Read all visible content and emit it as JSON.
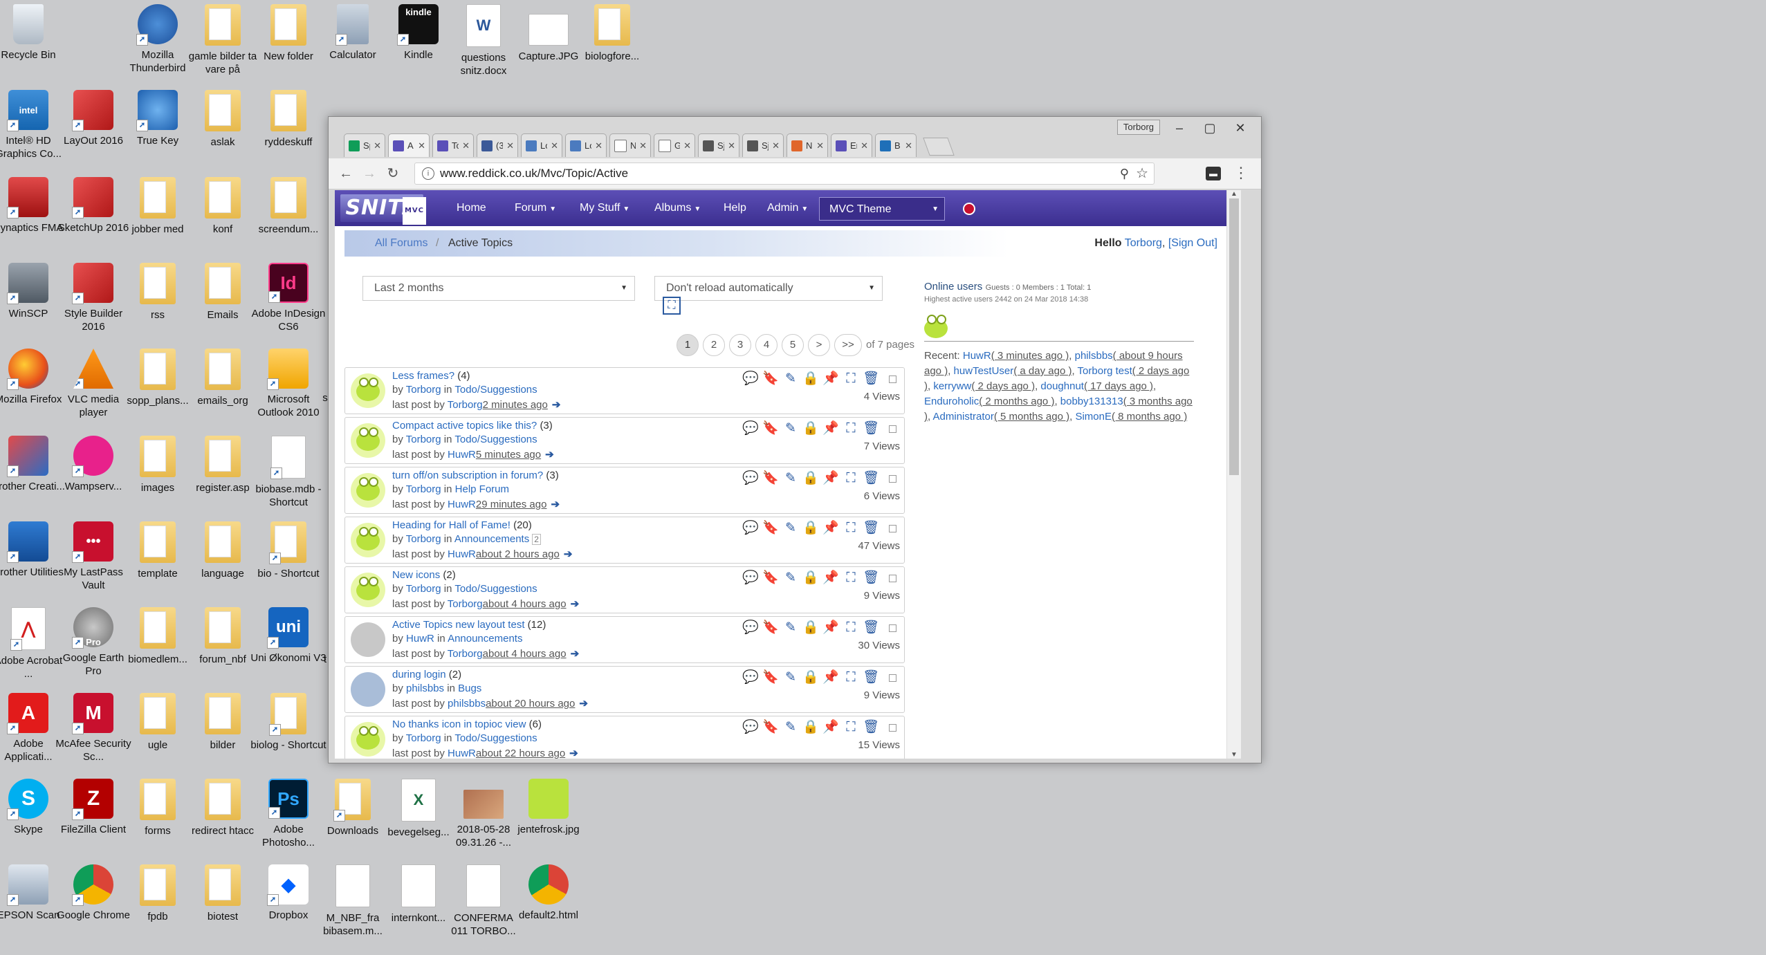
{
  "desktop": {
    "icons": [
      {
        "label": "Recycle Bin"
      },
      {
        "label": "Mozilla Thunderbird"
      },
      {
        "label": "gamle bilder ta vare på"
      },
      {
        "label": "New folder"
      },
      {
        "label": "Calculator"
      },
      {
        "label": "Kindle",
        "text": "kindle"
      },
      {
        "label": "questions snitz.docx"
      },
      {
        "label": "Capture.JPG"
      },
      {
        "label": "biologfore..."
      },
      {
        "label": "Intel® HD Graphics Co...",
        "text": "intel"
      },
      {
        "label": "LayOut 2016"
      },
      {
        "label": "True Key"
      },
      {
        "label": "aslak"
      },
      {
        "label": "ryddeskuff"
      },
      {
        "label": "Synaptics FMA"
      },
      {
        "label": "SketchUp 2016"
      },
      {
        "label": "jobber med"
      },
      {
        "label": "konf"
      },
      {
        "label": "screendum..."
      },
      {
        "label": "WinSCP"
      },
      {
        "label": "Style Builder 2016"
      },
      {
        "label": "rss"
      },
      {
        "label": "Emails"
      },
      {
        "label": "Adobe InDesign CS6",
        "text": "Id"
      },
      {
        "label": "Mozilla Firefox"
      },
      {
        "label": "VLC media player"
      },
      {
        "label": "sopp_plans..."
      },
      {
        "label": "emails_org"
      },
      {
        "label": "Microsoft Outlook 2010"
      },
      {
        "label": "s"
      },
      {
        "label": "Brother Creati..."
      },
      {
        "label": "Wampserv..."
      },
      {
        "label": "images"
      },
      {
        "label": "register.asp"
      },
      {
        "label": "biobase.mdb - Shortcut"
      },
      {
        "label": "Brother Utilities"
      },
      {
        "label": "My LastPass Vault"
      },
      {
        "label": "template"
      },
      {
        "label": "language"
      },
      {
        "label": "bio - Shortcut"
      },
      {
        "label": "Adobe Acrobat ..."
      },
      {
        "label": "Google Earth Pro",
        "text": "Pro"
      },
      {
        "label": "biomedlem..."
      },
      {
        "label": "forum_nbf"
      },
      {
        "label": "Uni Økonomi V3",
        "text": "uni"
      },
      {
        "label": "t"
      },
      {
        "label": "Adobe Applicati..."
      },
      {
        "label": "McAfee Security Sc..."
      },
      {
        "label": "ugle"
      },
      {
        "label": "bilder"
      },
      {
        "label": "biolog - Shortcut"
      },
      {
        "label": "Skype"
      },
      {
        "label": "FileZilla Client"
      },
      {
        "label": "forms"
      },
      {
        "label": "redirect htacc"
      },
      {
        "label": "Adobe Photosho...",
        "text": "Ps"
      },
      {
        "label": "Downloads"
      },
      {
        "label": "bevegelseg..."
      },
      {
        "label": "2018-05-28 09.31.26 -..."
      },
      {
        "label": "jentefrosk.jpg"
      },
      {
        "label": "EPSON Scan"
      },
      {
        "label": "Google Chrome"
      },
      {
        "label": "fpdb"
      },
      {
        "label": "biotest"
      },
      {
        "label": "Dropbox"
      },
      {
        "label": "M_NBF_fra bibasem.m..."
      },
      {
        "label": "internkont..."
      },
      {
        "label": "CONFERMA 011 TORBO..."
      },
      {
        "label": "default2.html"
      }
    ]
  },
  "browser": {
    "profile": "Torborg",
    "tabs": [
      {
        "title": "Sp"
      },
      {
        "title": "A"
      },
      {
        "title": "To"
      },
      {
        "title": "(3"
      },
      {
        "title": "Lo"
      },
      {
        "title": "Lo"
      },
      {
        "title": "N"
      },
      {
        "title": "G"
      },
      {
        "title": "Sj"
      },
      {
        "title": "Sj"
      },
      {
        "title": "N"
      },
      {
        "title": "Er"
      },
      {
        "title": "B"
      }
    ],
    "url": "www.reddick.co.uk/Mvc/Topic/Active"
  },
  "site": {
    "logo": "SNITZ",
    "logo_sub": "MVC",
    "nav": {
      "home": "Home",
      "forum": "Forum",
      "mystuff": "My Stuff",
      "albums": "Albums",
      "help": "Help",
      "admin": "Admin",
      "theme": "MVC Theme"
    },
    "breadcrumb": {
      "all_forums": "All Forums",
      "sep": "/",
      "current": "Active Topics"
    },
    "hello": {
      "prefix": "Hello",
      "user": "Torborg",
      "signout": "[Sign Out]"
    },
    "filters": {
      "period": "Last 2 months",
      "reload": "Don't reload automatically"
    },
    "pager": {
      "pages": [
        "1",
        "2",
        "3",
        "4",
        "5",
        ">",
        ">>"
      ],
      "text": "of 7 pages"
    },
    "topics": [
      {
        "title": "Less frames?",
        "count": "(4)",
        "by": "by",
        "author": "Torborg",
        "in": "in",
        "forum": "Todo/Suggestions",
        "lastpost": "last post by",
        "lastuser": "Torborg",
        "ago": "2 minutes ago",
        "views": "4 Views",
        "avatar": "frog"
      },
      {
        "title": "Compact active topics like this?",
        "count": "(3)",
        "by": "by",
        "author": "Torborg",
        "in": "in",
        "forum": "Todo/Suggestions",
        "lastpost": "last post by",
        "lastuser": "HuwR",
        "ago": "5 minutes ago",
        "views": "7 Views",
        "avatar": "frog"
      },
      {
        "title": "turn off/on subscription in forum?",
        "count": "(3)",
        "by": "by",
        "author": "Torborg",
        "in": "in",
        "forum": "Help Forum",
        "lastpost": "last post by",
        "lastuser": "HuwR",
        "ago": "29 minutes ago",
        "views": "6 Views",
        "avatar": "frog"
      },
      {
        "title": "Heading for Hall of Fame!",
        "count": "(20)",
        "by": "by",
        "author": "Torborg",
        "in": "in",
        "forum": "Announcements",
        "badge": "2",
        "lastpost": "last post by",
        "lastuser": "HuwR",
        "ago": "about 2 hours ago",
        "views": "47 Views",
        "avatar": "frog"
      },
      {
        "title": "New icons",
        "count": "(2)",
        "by": "by",
        "author": "Torborg",
        "in": "in",
        "forum": "Todo/Suggestions",
        "lastpost": "last post by",
        "lastuser": "Torborg",
        "ago": "about 4 hours ago",
        "views": "9 Views",
        "avatar": "frog"
      },
      {
        "title": "Active Topics new layout test",
        "count": "(12)",
        "by": "by",
        "author": "HuwR",
        "in": "in",
        "forum": "Announcements",
        "lastpost": "last post by",
        "lastuser": "Torborg",
        "ago": "about 4 hours ago",
        "views": "30 Views",
        "avatar": "grey"
      },
      {
        "title": "during login",
        "count": "(2)",
        "by": "by",
        "author": "philsbbs",
        "in": "in",
        "forum": "Bugs",
        "lastpost": "last post by",
        "lastuser": "philsbbs",
        "ago": "about 20 hours ago",
        "views": "9 Views",
        "avatar": "blue"
      },
      {
        "title": "No thanks icon in topioc view",
        "count": "(6)",
        "by": "by",
        "author": "Torborg",
        "in": "in",
        "forum": "Todo/Suggestions",
        "lastpost": "last post by",
        "lastuser": "HuwR",
        "ago": "about 22 hours ago",
        "views": "15 Views",
        "avatar": "frog"
      }
    ],
    "online": {
      "title": "Online users",
      "stats": "Guests : 0 Members : 1 Total: 1",
      "highest": "Highest active users 2442 on 24 Mar 2018 14:38",
      "recent_label": "Recent:",
      "recent": [
        {
          "user": "HuwR",
          "ago": "( 3 minutes ago )"
        },
        {
          "user": "philsbbs",
          "ago": "( about 9 hours ago )"
        },
        {
          "user": "huwTestUser",
          "ago": "( a day ago )"
        },
        {
          "user": "Torborg test",
          "ago": "( 2 days ago )"
        },
        {
          "user": "kerryww",
          "ago": "( 2 days ago )"
        },
        {
          "user": "doughnut",
          "ago": "( 17 days ago )"
        },
        {
          "user": "Enduroholic",
          "ago": "( 2 months ago )"
        },
        {
          "user": "bobby131313",
          "ago": "( 3 months ago )"
        },
        {
          "user": "Administrator",
          "ago": "( 5 months ago )"
        },
        {
          "user": "SimonE",
          "ago": "( 8 months ago )"
        }
      ]
    }
  }
}
